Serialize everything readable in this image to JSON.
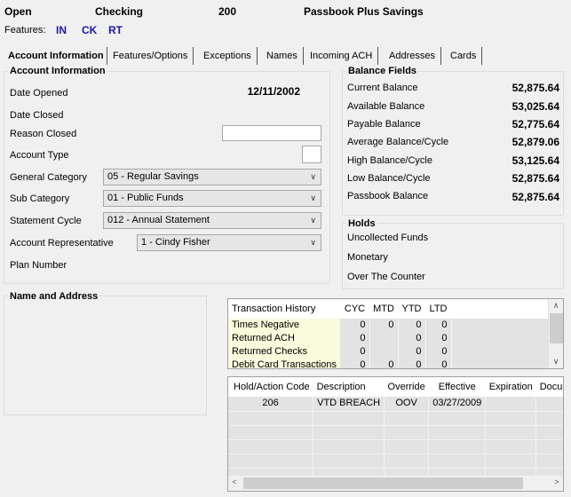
{
  "header": {
    "status": "Open",
    "account_type": "Checking",
    "product_code": "200",
    "product_name": "Passbook Plus Savings"
  },
  "features": {
    "label": "Features:",
    "codes": [
      "IN",
      "CK",
      "RT"
    ]
  },
  "tabs": [
    {
      "label": "Account Information",
      "active": true
    },
    {
      "label": "Features/Options",
      "active": false
    },
    {
      "label": "Exceptions",
      "active": false
    },
    {
      "label": "Names",
      "active": false
    },
    {
      "label": "Incoming ACH",
      "active": false
    },
    {
      "label": "Addresses",
      "active": false
    },
    {
      "label": "Cards",
      "active": false
    }
  ],
  "account_info": {
    "title": "Account Information",
    "date_opened_label": "Date Opened",
    "date_opened": "12/11/2002",
    "date_closed_label": "Date Closed",
    "date_closed": "",
    "reason_closed_label": "Reason Closed",
    "reason_closed": "",
    "account_type_label": "Account Type",
    "account_type": "",
    "general_category_label": "General Category",
    "general_category": "05 - Regular Savings",
    "sub_category_label": "Sub Category",
    "sub_category": "01 - Public Funds",
    "statement_cycle_label": "Statement Cycle",
    "statement_cycle": "012 - Annual Statement",
    "account_rep_label": "Account Representative",
    "account_rep": "1 - Cindy Fisher",
    "plan_number_label": "Plan Number",
    "plan_number": ""
  },
  "balance_fields": {
    "title": "Balance Fields",
    "items": [
      {
        "label": "Current Balance",
        "value": "52,875.64"
      },
      {
        "label": "Available Balance",
        "value": "53,025.64"
      },
      {
        "label": "Payable Balance",
        "value": "52,775.64"
      },
      {
        "label": "Average Balance/Cycle",
        "value": "52,879.06"
      },
      {
        "label": "High Balance/Cycle",
        "value": "53,125.64"
      },
      {
        "label": "Low Balance/Cycle",
        "value": "52,875.64"
      },
      {
        "label": "Passbook Balance",
        "value": "52,875.64"
      }
    ]
  },
  "holds": {
    "title": "Holds",
    "items": [
      "Uncollected Funds",
      "Monetary",
      "Over The Counter"
    ]
  },
  "name_address": {
    "title": "Name and Address"
  },
  "transaction_history": {
    "columns": [
      "Transaction History",
      "CYC",
      "MTD",
      "YTD",
      "LTD"
    ],
    "rows": [
      {
        "name": "Times Negative",
        "cyc": "0",
        "mtd": "0",
        "ytd": "0",
        "ltd": "0"
      },
      {
        "name": "Returned ACH",
        "cyc": "0",
        "mtd": "",
        "ytd": "0",
        "ltd": "0"
      },
      {
        "name": "Returned Checks",
        "cyc": "0",
        "mtd": "",
        "ytd": "0",
        "ltd": "0"
      },
      {
        "name": "Debit Card Transactions",
        "cyc": "0",
        "mtd": "0",
        "ytd": "0",
        "ltd": "0"
      }
    ]
  },
  "hold_actions": {
    "columns": [
      "Hold/Action Code",
      "Description",
      "Override",
      "Effective",
      "Expiration",
      "Docume"
    ],
    "rows": [
      {
        "code": "206",
        "description": "VTD BREACH",
        "override": "OOV",
        "effective": "03/27/2009",
        "expiration": "",
        "document": ""
      }
    ]
  },
  "icons": {
    "dropdown": "chevron-down-icon",
    "scroll_up": "chevron-up-icon",
    "scroll_down": "chevron-down-icon",
    "scroll_left": "chevron-left-icon",
    "scroll_right": "chevron-right-icon"
  },
  "colors": {
    "feature_code": "#1a1aa6",
    "history_name_bg": "#fafadc",
    "grid_cell_bg": "#e3e3e3"
  }
}
